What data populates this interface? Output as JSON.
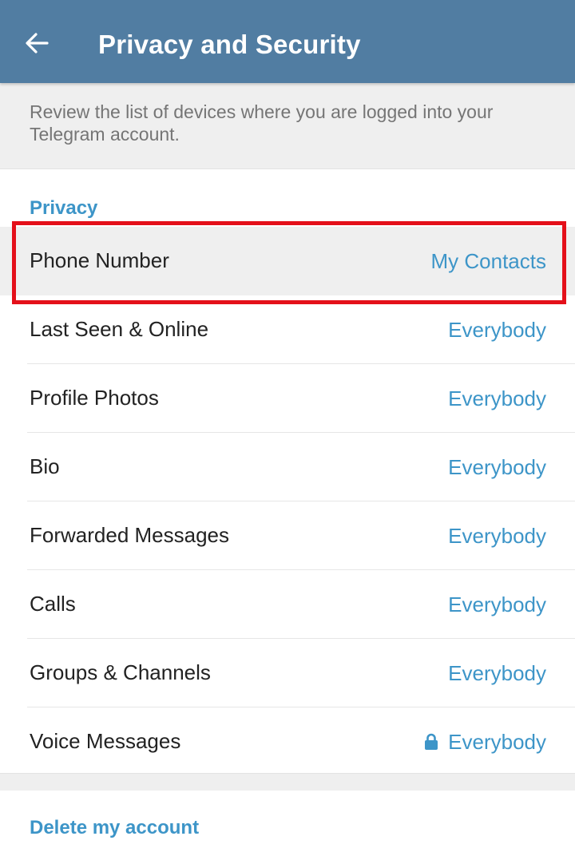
{
  "header": {
    "title": "Privacy and Security",
    "background": "#517da2"
  },
  "info": {
    "text": "Review the list of devices where you are logged into your Telegram account."
  },
  "privacy": {
    "section_title": "Privacy",
    "rows": [
      {
        "label": "Phone Number",
        "value": "My Contacts"
      },
      {
        "label": "Last Seen & Online",
        "value": "Everybody"
      },
      {
        "label": "Profile Photos",
        "value": "Everybody"
      },
      {
        "label": "Bio",
        "value": "Everybody"
      },
      {
        "label": "Forwarded Messages",
        "value": "Everybody"
      },
      {
        "label": "Calls",
        "value": "Everybody"
      },
      {
        "label": "Groups & Channels",
        "value": "Everybody"
      },
      {
        "label": "Voice Messages",
        "value": "Everybody"
      }
    ]
  },
  "delete_account": {
    "label": "Delete my account"
  },
  "colors": {
    "accent": "#3d95c8",
    "highlight_border": "#e4101a"
  }
}
